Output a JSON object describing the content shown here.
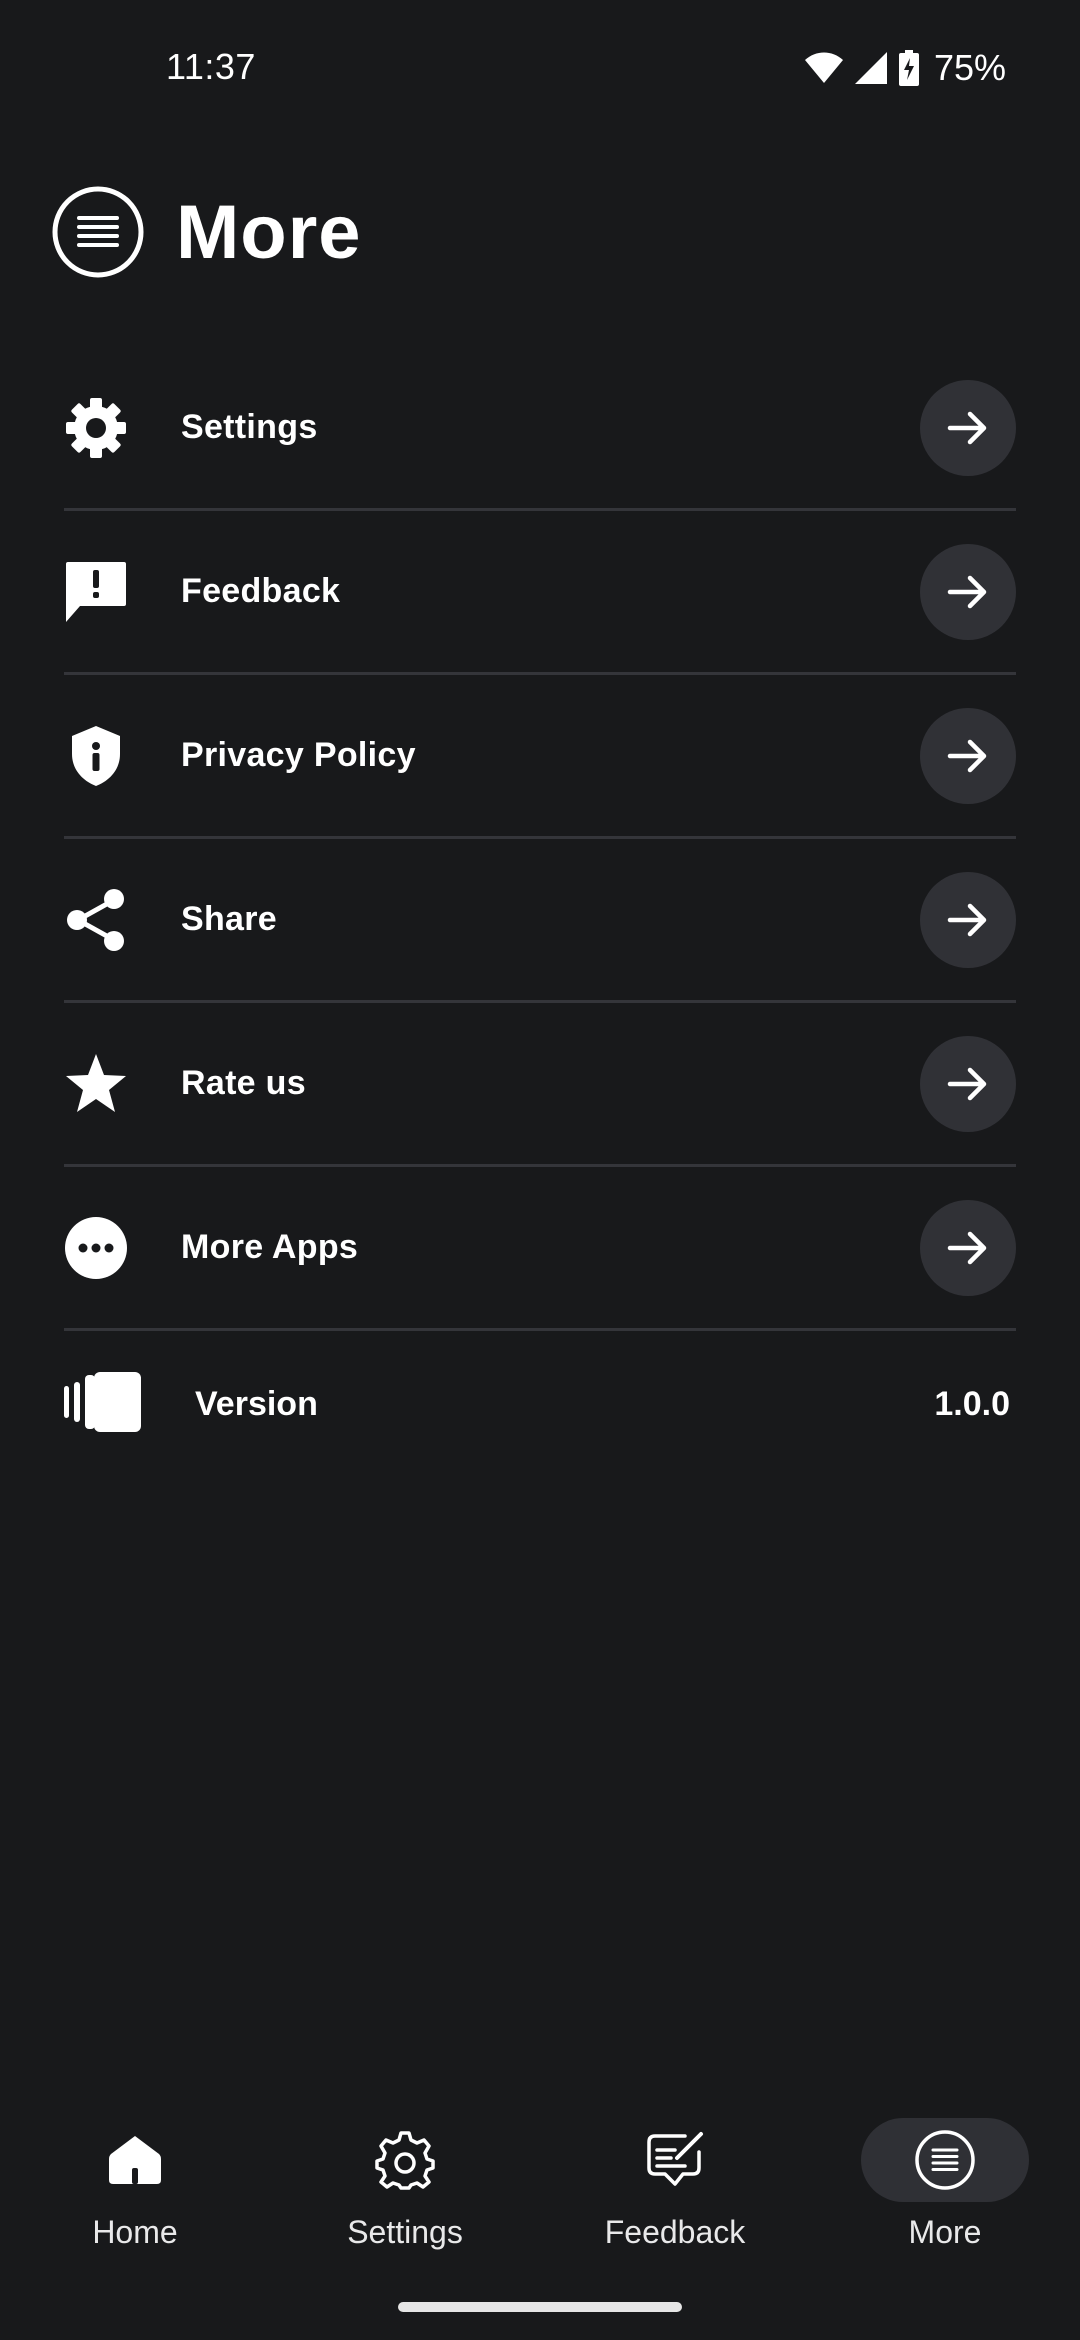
{
  "status_bar": {
    "time": "11:37",
    "battery": "75%"
  },
  "header": {
    "title": "More",
    "icon": "menu-lines-circle-icon"
  },
  "menu": {
    "items": [
      {
        "label": "Settings",
        "icon": "gear-icon"
      },
      {
        "label": "Feedback",
        "icon": "feedback-icon"
      },
      {
        "label": "Privacy Policy",
        "icon": "shield-info-icon"
      },
      {
        "label": "Share",
        "icon": "share-icon"
      },
      {
        "label": "Rate us",
        "icon": "star-icon"
      },
      {
        "label": "More Apps",
        "icon": "more-dots-icon"
      }
    ],
    "version": {
      "label": "Version",
      "value": "1.0.0",
      "icon": "cards-icon"
    }
  },
  "bottom_nav": {
    "items": [
      {
        "label": "Home",
        "icon": "home-icon"
      },
      {
        "label": "Settings",
        "icon": "gear-outline-icon"
      },
      {
        "label": "Feedback",
        "icon": "feedback-pen-icon"
      },
      {
        "label": "More",
        "icon": "menu-lines-circle-icon",
        "active": true
      }
    ]
  },
  "colors": {
    "background": "#18191b",
    "divider": "#34353a",
    "button": "#303136",
    "text": "#ffffff"
  }
}
